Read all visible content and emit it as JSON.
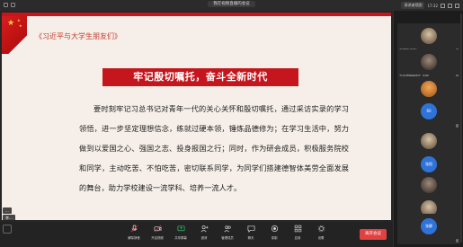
{
  "window": {
    "title": "我在视频直播的会议"
  },
  "topbar": {
    "view_label": "演讲者视图",
    "time": "17:32"
  },
  "slide": {
    "heading": "《习近平与大学生朋友们》",
    "banner": "牢记殷切嘱托，奋斗全新时代",
    "body": "要时刻牢记习总书记对青年一代的关心关怀和殷切嘱托，通过采访实录的学习领悟，进一步坚定理想信念，练就过硬本领，锤炼品德修为；在学习生活中，努力做到以爱国之心、强国之志、投身报国之行；同时，作为研会成员，积极服务院校和同学，主动吃苦、不怕吃苦，密切联系同学，为同学们搭建德智体美劳全面发展的舞台，助力学校建设一流学科、培养一流人才。"
  },
  "name_tags": [
    "...",
    "李..."
  ],
  "participants": [
    {
      "label": "王明明(主持)",
      "avatar": "photo"
    },
    {
      "label": "文化学院研究生 王明",
      "avatar": "dark"
    },
    {
      "label": "王二-外国语学院研究生",
      "avatar": "orange"
    },
    {
      "label": "60",
      "avatar": "blue"
    },
    {
      "label": "杨阳阳-20221100000",
      "avatar": "photo"
    },
    {
      "label": "张阳",
      "avatar": "blue"
    },
    {
      "label": "张思-20192100000",
      "avatar": "dark"
    },
    {
      "label": "周三某-20191100016",
      "avatar": "photo"
    },
    {
      "label": "张静",
      "avatar": "blue"
    }
  ],
  "toolbar": {
    "items": [
      "解除静音",
      "开启视频",
      "共享屏幕",
      "邀请",
      "管理成员",
      "聊天",
      "录制",
      "应用",
      "设置"
    ],
    "leave": "离开会议"
  }
}
